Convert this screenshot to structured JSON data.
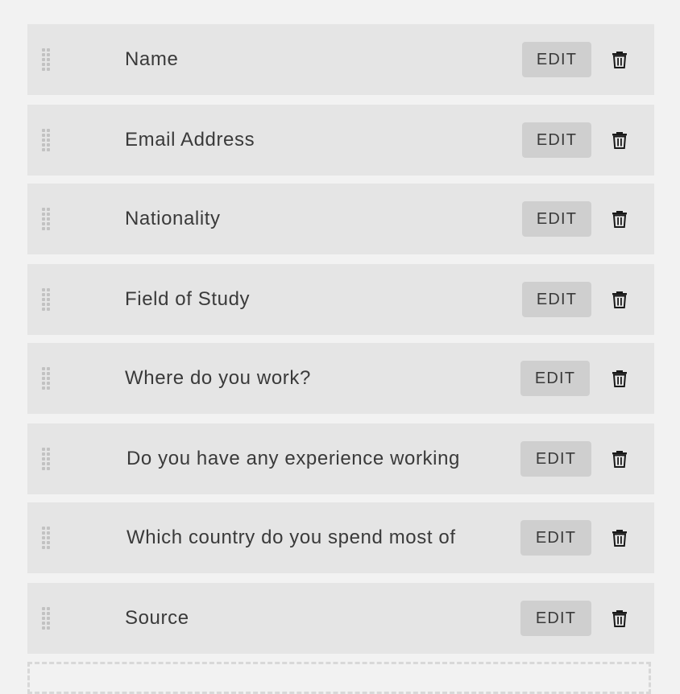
{
  "form_fields": {
    "edit_label": "EDIT",
    "items": [
      {
        "label": "Name"
      },
      {
        "label": "Email Address"
      },
      {
        "label": "Nationality"
      },
      {
        "label": "Field of Study"
      },
      {
        "label": "Where do you work?"
      },
      {
        "label": "Do you have any experience working"
      },
      {
        "label": "Which country do you spend most of"
      },
      {
        "label": "Source"
      }
    ]
  },
  "icons": {
    "drag": "drag-handle-icon",
    "delete": "trash-icon"
  },
  "colors": {
    "page_background": "#f2f2f2",
    "row_background": "#e5e5e5",
    "button_background": "#cfcfcf",
    "text": "#3a3a3a"
  }
}
